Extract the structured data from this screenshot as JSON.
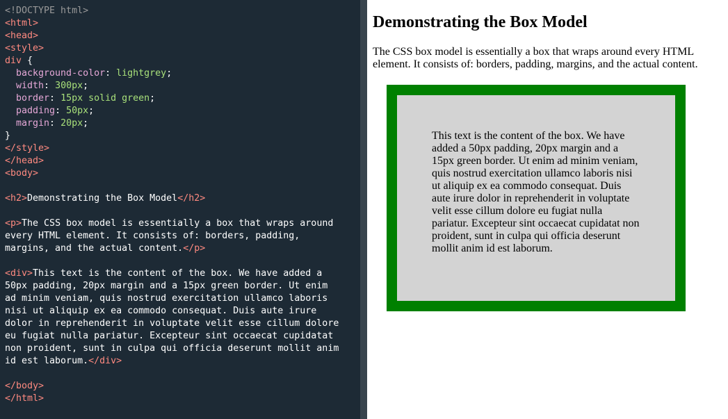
{
  "editor": {
    "lines": [
      [
        {
          "t": "<!DOCTYPE html>",
          "c": "doctype"
        }
      ],
      [
        {
          "t": "<html>",
          "c": "tag"
        }
      ],
      [
        {
          "t": "<head>",
          "c": "tag"
        }
      ],
      [
        {
          "t": "<style>",
          "c": "tag"
        }
      ],
      [
        {
          "t": "div",
          "c": "sel"
        },
        {
          "t": " {",
          "c": "text"
        }
      ],
      [
        {
          "t": "  background-color",
          "c": "prop"
        },
        {
          "t": ": ",
          "c": "text"
        },
        {
          "t": "lightgrey",
          "c": "val"
        },
        {
          "t": ";",
          "c": "text"
        }
      ],
      [
        {
          "t": "  width",
          "c": "prop"
        },
        {
          "t": ": ",
          "c": "text"
        },
        {
          "t": "300px",
          "c": "val"
        },
        {
          "t": ";",
          "c": "text"
        }
      ],
      [
        {
          "t": "  border",
          "c": "prop"
        },
        {
          "t": ": ",
          "c": "text"
        },
        {
          "t": "15px solid green",
          "c": "val"
        },
        {
          "t": ";",
          "c": "text"
        }
      ],
      [
        {
          "t": "  padding",
          "c": "prop"
        },
        {
          "t": ": ",
          "c": "text"
        },
        {
          "t": "50px",
          "c": "val"
        },
        {
          "t": ";",
          "c": "text"
        }
      ],
      [
        {
          "t": "  margin",
          "c": "prop"
        },
        {
          "t": ": ",
          "c": "text"
        },
        {
          "t": "20px",
          "c": "val"
        },
        {
          "t": ";",
          "c": "text"
        }
      ],
      [
        {
          "t": "}",
          "c": "text"
        }
      ],
      [
        {
          "t": "</style>",
          "c": "tag"
        }
      ],
      [
        {
          "t": "</head>",
          "c": "tag"
        }
      ],
      [
        {
          "t": "<body>",
          "c": "tag"
        }
      ],
      [],
      [
        {
          "t": "<h2>",
          "c": "tag"
        },
        {
          "t": "Demonstrating the Box Model",
          "c": "text"
        },
        {
          "t": "</h2>",
          "c": "tag"
        }
      ],
      [],
      [
        {
          "t": "<p>",
          "c": "tag"
        },
        {
          "t": "The CSS box model is essentially a box that wraps around",
          "c": "text"
        }
      ],
      [
        {
          "t": "every HTML element. It consists of: borders, padding,",
          "c": "text"
        }
      ],
      [
        {
          "t": "margins, and the actual content.",
          "c": "text"
        },
        {
          "t": "</p>",
          "c": "tag"
        }
      ],
      [],
      [
        {
          "t": "<div>",
          "c": "tag"
        },
        {
          "t": "This text is the content of the box. We have added a",
          "c": "text"
        }
      ],
      [
        {
          "t": "50px padding, 20px margin and a 15px green border. Ut enim",
          "c": "text"
        }
      ],
      [
        {
          "t": "ad minim veniam, quis nostrud exercitation ullamco laboris",
          "c": "text"
        }
      ],
      [
        {
          "t": "nisi ut aliquip ex ea commodo consequat. Duis aute irure",
          "c": "text"
        }
      ],
      [
        {
          "t": "dolor in reprehenderit in voluptate velit esse cillum dolore",
          "c": "text"
        }
      ],
      [
        {
          "t": "eu fugiat nulla pariatur. Excepteur sint occaecat cupidatat",
          "c": "text"
        }
      ],
      [
        {
          "t": "non proident, sunt in culpa qui officia deserunt mollit anim",
          "c": "text"
        }
      ],
      [
        {
          "t": "id est laborum.",
          "c": "text"
        },
        {
          "t": "</div>",
          "c": "tag"
        }
      ],
      [],
      [
        {
          "t": "</body>",
          "c": "tag"
        }
      ],
      [
        {
          "t": "</html>",
          "c": "tag"
        }
      ]
    ]
  },
  "preview": {
    "title": "Demonstrating the Box Model",
    "paragraph": "The CSS box model is essentially a box that wraps around every HTML element. It consists of: borders, padding, margins, and the actual content.",
    "box_text": "This text is the content of the box. We have added a 50px padding, 20px margin and a 15px green border. Ut enim ad minim veniam, quis nostrud exercitation ullamco laboris nisi ut aliquip ex ea commodo consequat. Duis aute irure dolor in reprehenderit in voluptate velit esse cillum dolore eu fugiat nulla pariatur. Excepteur sint occaecat cupidatat non proident, sunt in culpa qui officia deserunt mollit anim id est laborum."
  },
  "colors": {
    "editor_bg": "#1d2a35",
    "divider": "#38444d",
    "tag": "#ff8a80",
    "property": "#e6a8d8",
    "value": "#a8e07a",
    "doctype": "#999999",
    "box_border": "green",
    "box_bg": "lightgrey"
  }
}
